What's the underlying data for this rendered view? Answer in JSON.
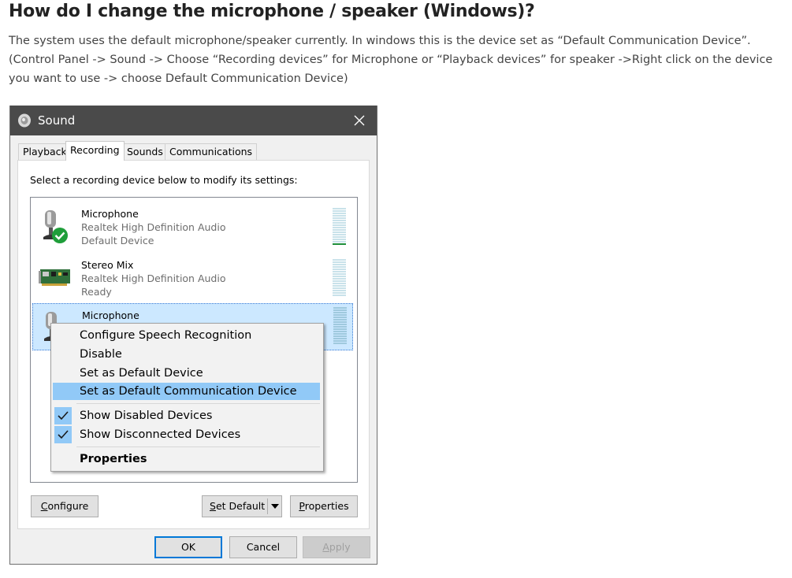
{
  "article": {
    "title": "How do I change the microphone / speaker (Windows)?",
    "body": "The system uses the default microphone/speaker currently.  In windows this is the device set as “Default Communication Device”. (Control Panel -> Sound -> Choose “Recording devices” for Microphone or “Playback devices” for speaker ->Right click on the device you want to use -> choose Default Communication Device)"
  },
  "window": {
    "title": "Sound",
    "close_icon": "close-icon",
    "tabs": [
      {
        "label": "Playback"
      },
      {
        "label": "Recording"
      },
      {
        "label": "Sounds"
      },
      {
        "label": "Communications"
      }
    ],
    "active_tab": "Recording",
    "instruction": "Select a recording device below to modify its settings:",
    "devices": [
      {
        "name": "Microphone",
        "driver": "Realtek High Definition Audio",
        "status": "Default Device",
        "icon": "microphone-default-icon"
      },
      {
        "name": "Stereo Mix",
        "driver": "Realtek High Definition Audio",
        "status": "Ready",
        "icon": "sound-card-icon"
      },
      {
        "name": "Microphone",
        "icon": "microphone-icon",
        "selected": true
      }
    ],
    "buttons": {
      "configure_accel": "C",
      "configure_rest": "onfigure",
      "set_default_accel": "S",
      "set_default_rest": "et Default",
      "properties_accel": "P",
      "properties_rest": "roperties",
      "ok": "OK",
      "cancel": "Cancel",
      "apply_accel": "A",
      "apply_rest": "pply"
    }
  },
  "context_menu": {
    "items": [
      {
        "label": "Configure Speech Recognition"
      },
      {
        "label": "Disable"
      },
      {
        "label": "Set as Default Device"
      },
      {
        "label": "Set as Default Communication Device",
        "highlighted": true
      },
      {
        "label": "Show Disabled Devices",
        "checked": true
      },
      {
        "label": "Show Disconnected Devices",
        "checked": true
      },
      {
        "label": "Properties",
        "bold": true
      }
    ]
  },
  "colors": {
    "titlebar": "#4a4a4a",
    "selection": "#cce8ff",
    "menu_highlight": "#91c9f7",
    "default_check": "#1f9e3a"
  }
}
